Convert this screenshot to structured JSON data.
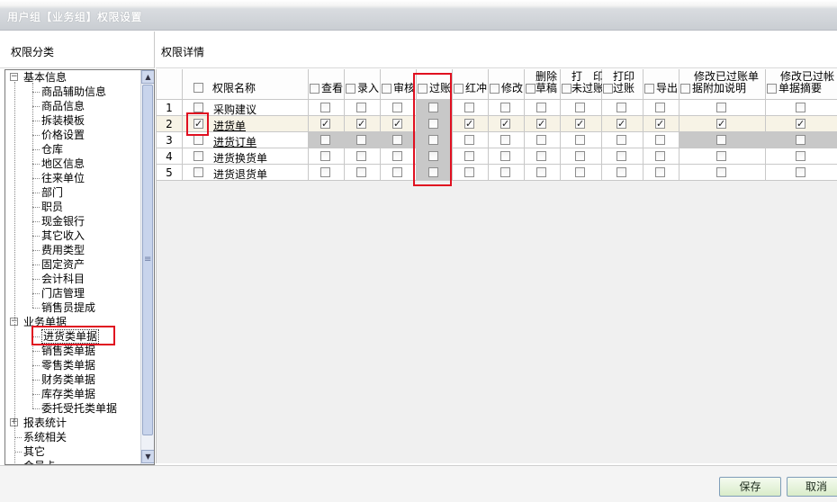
{
  "window": {
    "title": "用户组【业务组】权限设置"
  },
  "left_panel": {
    "header": "权限分类"
  },
  "right_panel": {
    "header": "权限详情"
  },
  "tree": {
    "groups": [
      {
        "label": "基本信息",
        "children": [
          "商品辅助信息",
          "商品信息",
          "拆装模板",
          "价格设置",
          "仓库",
          "地区信息",
          "往来单位",
          "部门",
          "职员",
          "现金银行",
          "其它收入",
          "费用类型",
          "固定资产",
          "会计科目",
          "门店管理",
          "销售员提成"
        ]
      },
      {
        "label": "业务单据",
        "children": [
          "进货类单据",
          "销售类单据",
          "零售类单据",
          "财务类单据",
          "库存类单据",
          "委托受托类单据"
        ],
        "selected_child": 0
      },
      {
        "label": "报表统计",
        "children": []
      }
    ],
    "roots": [
      "系统相关",
      "其它",
      "会员卡"
    ]
  },
  "table": {
    "name_header": "权限名称",
    "columns": [
      {
        "label": "查看"
      },
      {
        "label": "录入"
      },
      {
        "label": "审核"
      },
      {
        "label": "过账"
      },
      {
        "label": "红冲"
      },
      {
        "label": "修改"
      },
      {
        "label_top": "删除",
        "label_bottom": "草稿"
      },
      {
        "label_top": "打　印",
        "label_bottom": "未过账"
      },
      {
        "label_top": "打印",
        "label_bottom": "过账"
      },
      {
        "label": "导出"
      },
      {
        "label_top": "修改已过账单",
        "label_bottom": "据附加说明"
      },
      {
        "label_top": "修改已过帐",
        "label_bottom": "单据摘要"
      }
    ],
    "rows": [
      {
        "num": "1",
        "name": "采购建议",
        "checked": false,
        "link": false,
        "values": [
          false,
          false,
          false,
          false,
          false,
          false,
          false,
          false,
          false,
          false,
          false,
          false
        ]
      },
      {
        "num": "2",
        "name": "进货单",
        "checked": true,
        "link": true,
        "values": [
          true,
          true,
          true,
          false,
          true,
          true,
          true,
          true,
          true,
          true,
          true,
          true
        ]
      },
      {
        "num": "3",
        "name": "进货订单",
        "checked": false,
        "link": true,
        "values": [
          false,
          false,
          false,
          false,
          false,
          false,
          false,
          false,
          false,
          false,
          false,
          false
        ]
      },
      {
        "num": "4",
        "name": "进货换货单",
        "checked": false,
        "link": false,
        "values": [
          false,
          false,
          false,
          false,
          false,
          false,
          false,
          false,
          false,
          false,
          false,
          false
        ]
      },
      {
        "num": "5",
        "name": "进货退货单",
        "checked": false,
        "link": false,
        "values": [
          false,
          false,
          false,
          false,
          false,
          false,
          false,
          false,
          false,
          false,
          false,
          false
        ]
      }
    ]
  },
  "buttons": {
    "save": "保存",
    "cancel": "取消"
  },
  "colors": {
    "highlight_box": "#e01020",
    "disabled_cell": "#c8c8c8",
    "button_bg": "#d9ecc9"
  }
}
